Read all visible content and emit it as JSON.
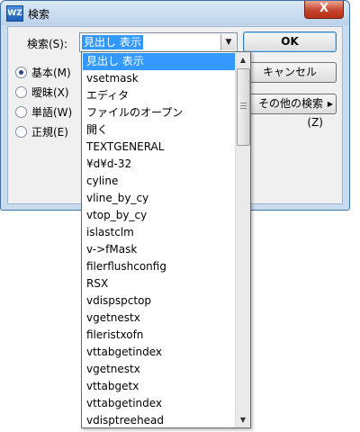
{
  "window": {
    "title": "検索",
    "app_icon_text": "WZ",
    "close_label": "X"
  },
  "form": {
    "search_label": "検索(S):",
    "combo_value": "見出し 表示"
  },
  "buttons": {
    "ok": "OK",
    "cancel": "キャンセル",
    "other": "その他の検索(Z)"
  },
  "radios": [
    {
      "label": "基本(M)",
      "checked": true
    },
    {
      "label": "曖昧(X)",
      "checked": false
    },
    {
      "label": "単語(W)",
      "checked": false
    },
    {
      "label": "正規(E)",
      "checked": false
    }
  ],
  "dropdown_items": [
    "見出し 表示",
    "vsetmask",
    "エディタ",
    "ファイルのオープン",
    "開く",
    "TEXTGENERAL",
    "¥d¥d-32",
    "cyline",
    "vline_by_cy",
    "vtop_by_cy",
    "islastclm",
    "v->fMask",
    "filerflushconfig",
    "RSX",
    "vdispspctop",
    "vgetnestx",
    "fileristxofn",
    "vttabgetindex",
    "vgetnestx",
    "vttabgetx",
    "vttabgetindex",
    "vdisptreehead"
  ],
  "icons": {
    "dropdown_arrow": "chevron-down-icon",
    "scroll_up": "scroll-up-arrow-icon",
    "scroll_down": "scroll-down-arrow-icon",
    "other_arrow": "chevron-right-icon"
  }
}
